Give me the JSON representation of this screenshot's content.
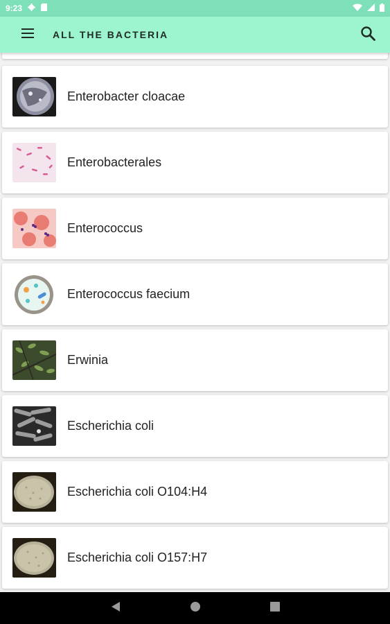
{
  "status_bar": {
    "time": "9:23",
    "left_icons": [
      "gear-icon",
      "sd-card-icon"
    ],
    "right_icons": [
      "wifi-icon",
      "cellular-icon",
      "battery-icon"
    ]
  },
  "app_bar": {
    "title": "ALL THE BACTERIA",
    "menu_icon": "hamburger-menu-icon",
    "search_icon": "search-icon"
  },
  "bacteria": [
    {
      "name": "Enterobacter cloacae",
      "thumbnail": "petri-dish-dark-photo"
    },
    {
      "name": "Enterobacterales",
      "thumbnail": "pink-rod-microscopy"
    },
    {
      "name": "Enterococcus",
      "thumbnail": "red-cell-microscopy"
    },
    {
      "name": "Enterococcus faecium",
      "thumbnail": "cartoon-petri-dish"
    },
    {
      "name": "Erwinia",
      "thumbnail": "plant-leaves-photo"
    },
    {
      "name": "Escherichia coli",
      "thumbnail": "electron-micrograph"
    },
    {
      "name": "Escherichia coli O104:H4",
      "thumbnail": "agar-plate-photo"
    },
    {
      "name": "Escherichia coli O157:H7",
      "thumbnail": "agar-plate-photo"
    }
  ],
  "nav_bar": {
    "icons": [
      "back-icon",
      "home-icon",
      "recents-icon"
    ]
  }
}
